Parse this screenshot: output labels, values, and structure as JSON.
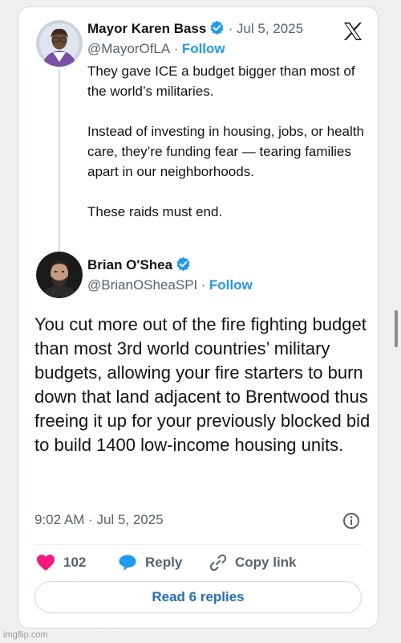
{
  "original_tweet": {
    "author_name": "Mayor Karen Bass",
    "handle": "@MayorOfLA",
    "separator": "·",
    "date": "Jul 5, 2025",
    "follow_label": "Follow",
    "text": "They gave ICE a budget bigger than most of the world’s militaries.\n\nInstead of investing in housing, jobs, or health care, they’re funding fear — tearing families apart in our neighborhoods.\n\nThese raids must end."
  },
  "reply_tweet": {
    "author_name": "Brian O'Shea",
    "handle": "@BrianOSheaSPI",
    "separator": "·",
    "follow_label": "Follow",
    "text": "You cut more out of the fire fighting budget than most 3rd world countries’ military budgets, allowing your fire starters to burn down that land adjacent to Brentwood thus freeing it up for your previously blocked bid to build 1400 low-income housing units.",
    "timestamp": "9:02 AM · Jul 5, 2025",
    "like_count": "102",
    "reply_label": "Reply",
    "copy_link_label": "Copy link",
    "read_replies_label": "Read 6 replies"
  },
  "icons": {
    "brand": "x-logo-icon",
    "verified": "verified-badge-icon",
    "info": "info-icon",
    "like": "heart-icon",
    "reply": "speech-bubble-icon",
    "copy": "link-icon"
  },
  "colors": {
    "accent": "#1d9bf0",
    "like": "#f91880",
    "text": "#0f1419",
    "muted": "#536471"
  },
  "watermark": "imgflip.com"
}
